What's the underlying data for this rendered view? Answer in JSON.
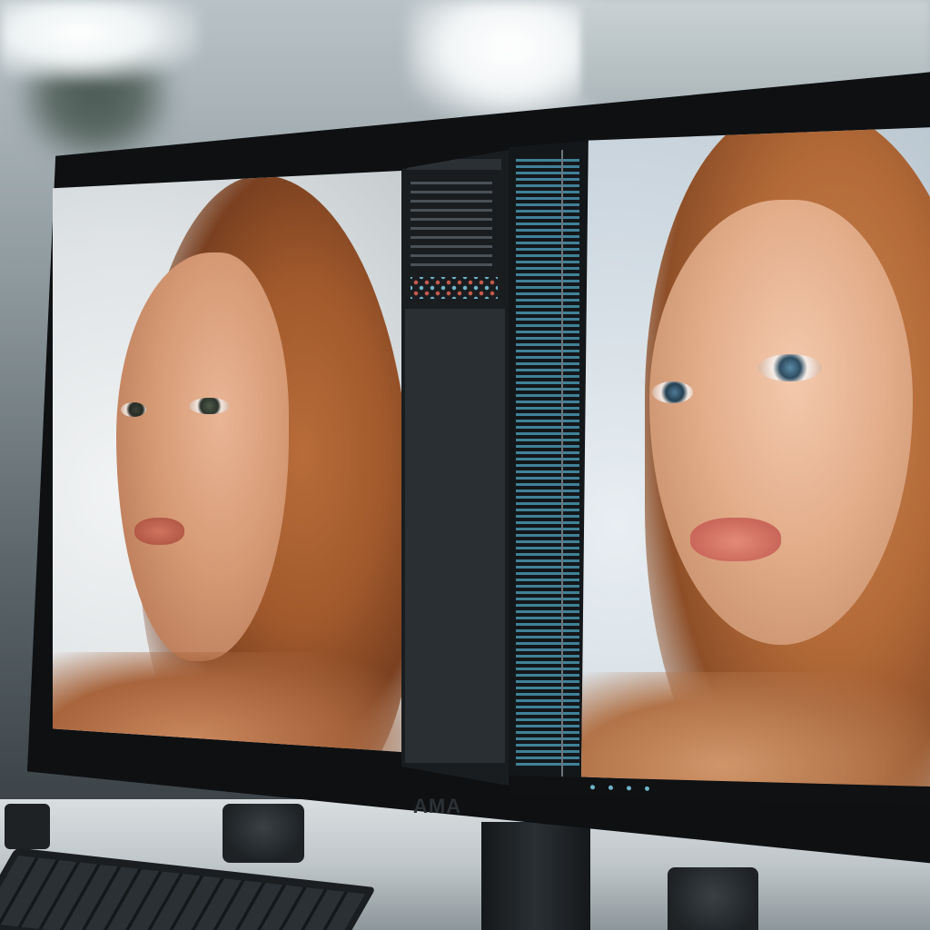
{
  "scene": {
    "monitor_brand": "AMA",
    "accent_colors": {
      "timeline_blue": "#4fa6c3",
      "panel_red": "#c55a4a",
      "hair_copper": "#b86c3a"
    }
  }
}
